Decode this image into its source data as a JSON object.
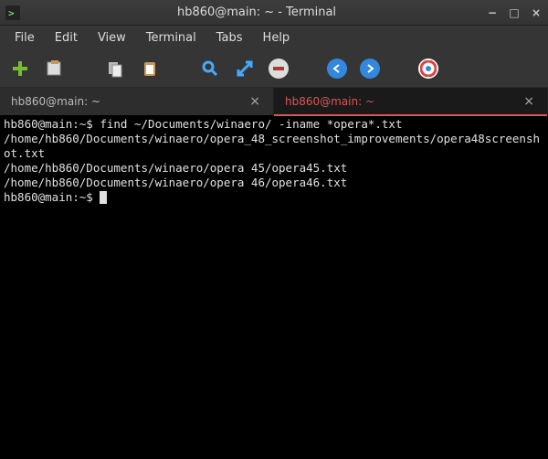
{
  "window": {
    "title": "hb860@main: ~ - Terminal",
    "minimize": "−",
    "maximize": "□",
    "close": "×"
  },
  "menubar": [
    "File",
    "Edit",
    "View",
    "Terminal",
    "Tabs",
    "Help"
  ],
  "toolbar": {
    "icons": [
      "new-tab-icon",
      "new-window-icon",
      "copy-icon",
      "paste-icon",
      "search-icon",
      "fullscreen-icon",
      "preferences-icon",
      "back-icon",
      "forward-icon",
      "help-icon"
    ]
  },
  "tabs": [
    {
      "label": "hb860@main: ~",
      "active": false
    },
    {
      "label": "hb860@main: ~",
      "active": true
    }
  ],
  "terminal": {
    "lines": [
      {
        "prompt": "hb860@main:~$ ",
        "cmd": "find ~/Documents/winaero/ -iname *opera*.txt"
      },
      {
        "out": "/home/hb860/Documents/winaero/opera_48_screenshot_improvements/opera48screenshot.txt"
      },
      {
        "out": "/home/hb860/Documents/winaero/opera 45/opera45.txt"
      },
      {
        "out": "/home/hb860/Documents/winaero/opera 46/opera46.txt"
      },
      {
        "prompt": "hb860@main:~$ ",
        "cmd": ""
      }
    ]
  }
}
